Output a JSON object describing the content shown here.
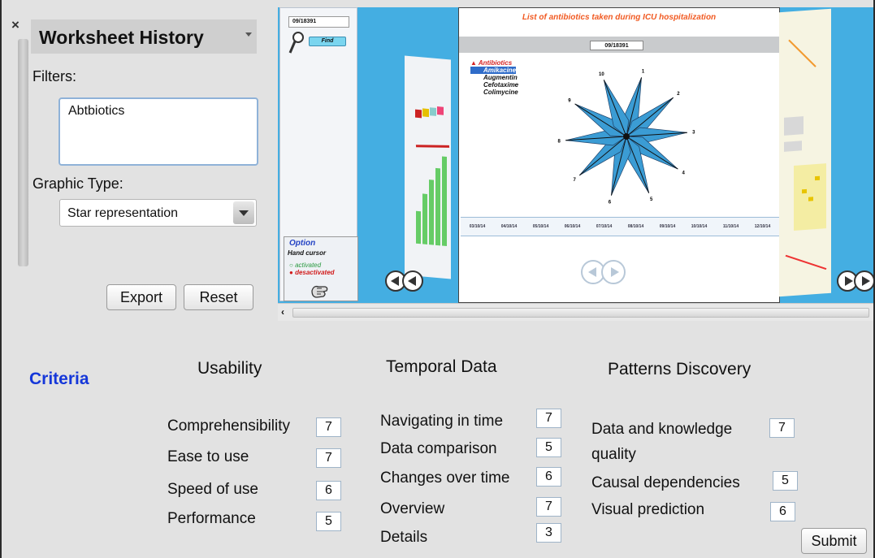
{
  "sidebar": {
    "close_symbol": "×",
    "title": "Worksheet History",
    "filters_label": "Filters:",
    "filters_value": "Abtbiotics",
    "graphic_type_label": "Graphic Type:",
    "graphic_type_value": "Star representation",
    "export_label": "Export",
    "reset_label": "Reset"
  },
  "viewer": {
    "search_value": "09/18391",
    "find_label": "Find",
    "option_title": "Option",
    "hand_cursor_label": "Hand cursor",
    "activated_label": "activated",
    "deactivated_label": "desactivated",
    "card_title": "List of antibiotics taken during ICU hospitalization",
    "card_id": "09/18391",
    "antibiotics_header": "Antibiotics",
    "antibiotics": [
      "Amikacine",
      "Augmentin",
      "Cefotaxime",
      "Colimycine"
    ],
    "selected_antibiotic": "Amikacine",
    "star_labels": [
      "1",
      "2",
      "3",
      "4",
      "5",
      "6",
      "7",
      "8",
      "9",
      "10"
    ],
    "dates": [
      "03/10/14",
      "04/10/14",
      "05/10/14",
      "06/10/14",
      "07/10/14",
      "08/10/14",
      "09/10/14",
      "10/10/14",
      "11/10/14",
      "12/10/14"
    ],
    "colors": {
      "background": "#44aee2",
      "star_fill": "#3b9cd4",
      "title": "#f15a22"
    }
  },
  "evaluation": {
    "criteria_label": "Criteria",
    "usability": {
      "title": "Usability",
      "items": [
        {
          "label": "Comprehensibility",
          "score": "7"
        },
        {
          "label": "Ease to use",
          "score": "7"
        },
        {
          "label": "Speed of use",
          "score": "6"
        },
        {
          "label": "Performance",
          "score": "5"
        }
      ]
    },
    "temporal": {
      "title": "Temporal Data",
      "items": [
        {
          "label": "Navigating in time",
          "score": "7"
        },
        {
          "label": "Data comparison",
          "score": "5"
        },
        {
          "label": "Changes over time",
          "score": "6"
        },
        {
          "label": "Overview",
          "score": "7"
        },
        {
          "label": "Details",
          "score": "3"
        }
      ]
    },
    "patterns": {
      "title": "Patterns Discovery",
      "items": [
        {
          "label": "Data and knowledge",
          "label_line2": "quality",
          "score": "7"
        },
        {
          "label": "Causal dependencies",
          "score": "5"
        },
        {
          "label": "Visual prediction",
          "score": "6"
        }
      ]
    },
    "submit_label": "Submit"
  }
}
